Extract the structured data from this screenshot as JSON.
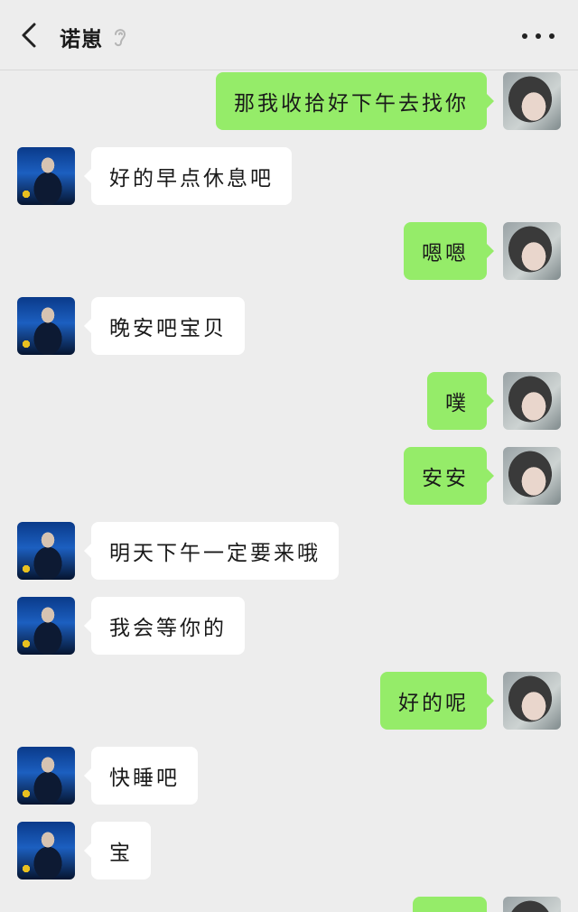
{
  "header": {
    "title": "诺崽"
  },
  "messages": [
    {
      "side": "right",
      "text": "那我收拾好下午去找你"
    },
    {
      "side": "left",
      "text": "好的早点休息吧"
    },
    {
      "side": "right",
      "text": "嗯嗯"
    },
    {
      "side": "left",
      "text": "晚安吧宝贝"
    },
    {
      "side": "right",
      "text": "噗"
    },
    {
      "side": "right",
      "text": "安安"
    },
    {
      "side": "left",
      "text": "明天下午一定要来哦"
    },
    {
      "side": "left",
      "text": "我会等你的"
    },
    {
      "side": "right",
      "text": "好的呢"
    },
    {
      "side": "left",
      "text": "快睡吧"
    },
    {
      "side": "left",
      "text": "宝"
    },
    {
      "side": "right",
      "text": ""
    }
  ],
  "icons": {
    "back": "chevron-left-icon",
    "mute": "ear-icon",
    "more": "more-dots-icon"
  },
  "colors": {
    "background": "#ededed",
    "sent_bubble": "#95ec69",
    "received_bubble": "#ffffff"
  }
}
